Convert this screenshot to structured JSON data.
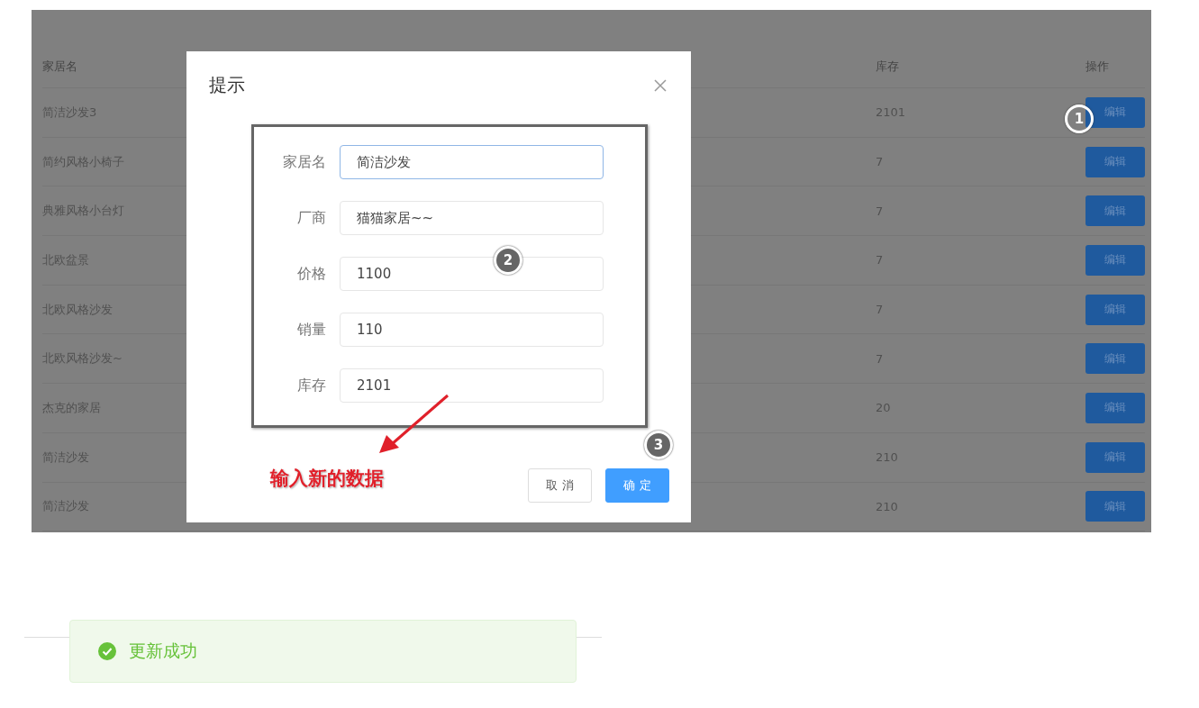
{
  "table": {
    "columns": [
      "家居名",
      "库存",
      "操作"
    ],
    "rows": [
      {
        "name": "简洁沙发3",
        "stock": "2101",
        "action": "编辑"
      },
      {
        "name": "简约风格小椅子",
        "stock": "7",
        "action": "编辑"
      },
      {
        "name": "典雅风格小台灯",
        "stock": "7",
        "action": "编辑"
      },
      {
        "name": "北欧盆景",
        "stock": "7",
        "action": "编辑"
      },
      {
        "name": "北欧风格沙发",
        "stock": "7",
        "action": "编辑"
      },
      {
        "name": "北欧风格沙发~",
        "stock": "7",
        "action": "编辑"
      },
      {
        "name": "杰克的家居",
        "stock": "20",
        "action": "编辑"
      },
      {
        "name": "简洁沙发",
        "stock": "210",
        "action": "编辑"
      },
      {
        "name": "简洁沙发",
        "stock": "210",
        "action": "编辑"
      }
    ]
  },
  "dialog": {
    "title": "提示",
    "fields": [
      {
        "label": "家居名",
        "value": "简洁沙发",
        "focused": true
      },
      {
        "label": "厂商",
        "value": "猫猫家居~~",
        "focused": false
      },
      {
        "label": "价格",
        "value": "1100",
        "focused": false
      },
      {
        "label": "销量",
        "value": "110",
        "focused": false
      },
      {
        "label": "库存",
        "value": "2101",
        "focused": false
      }
    ],
    "buttons": [
      {
        "label": "取 消",
        "kind": "default"
      },
      {
        "label": "确 定",
        "kind": "primary"
      }
    ]
  },
  "annotations": {
    "steps": [
      "1",
      "2",
      "3"
    ],
    "callout": "输入新的数据"
  },
  "toast": {
    "kind": "success",
    "message": "更新成功"
  }
}
